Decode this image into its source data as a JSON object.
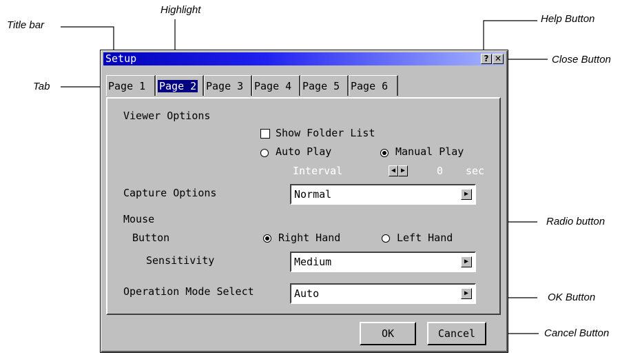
{
  "callouts": {
    "title_bar": "Title bar",
    "highlight": "Highlight",
    "help_button": "Help Button",
    "close_button": "Close Button",
    "tab": "Tab",
    "radio_button": "Radio button",
    "ok_button": "OK Button",
    "cancel_button": "Cancel Button"
  },
  "dialog": {
    "title": "Setup",
    "help_glyph": "?",
    "close_glyph": "✕",
    "tabs": [
      {
        "label": "Page 1",
        "active": false
      },
      {
        "label": "Page 2",
        "active": true
      },
      {
        "label": "Page 3",
        "active": false
      },
      {
        "label": "Page 4",
        "active": false
      },
      {
        "label": "Page 5",
        "active": false
      },
      {
        "label": "Page 6",
        "active": false
      }
    ],
    "viewer_options": {
      "heading": "Viewer Options",
      "show_folder_list": "Show Folder List",
      "show_folder_list_checked": false,
      "auto_play": "Auto Play",
      "manual_play": "Manual Play",
      "selected_play_mode": "manual",
      "interval_label": "Interval",
      "interval_value": "0",
      "interval_unit": "sec"
    },
    "capture_options": {
      "label": "Capture Options",
      "value": "Normal"
    },
    "mouse": {
      "heading": "Mouse",
      "button_label": "Button",
      "right_hand": "Right Hand",
      "left_hand": "Left Hand",
      "selected_hand": "right",
      "sensitivity_label": "Sensitivity",
      "sensitivity_value": "Medium"
    },
    "operation_mode": {
      "label": "Operation Mode Select",
      "value": "Auto"
    },
    "ok_label": "OK",
    "cancel_label": "Cancel"
  },
  "colors": {
    "titlebar_start": "#0000b8",
    "titlebar_end": "#a8b8ff",
    "highlight": "#000080",
    "dialog_face": "#c0c0c0"
  }
}
